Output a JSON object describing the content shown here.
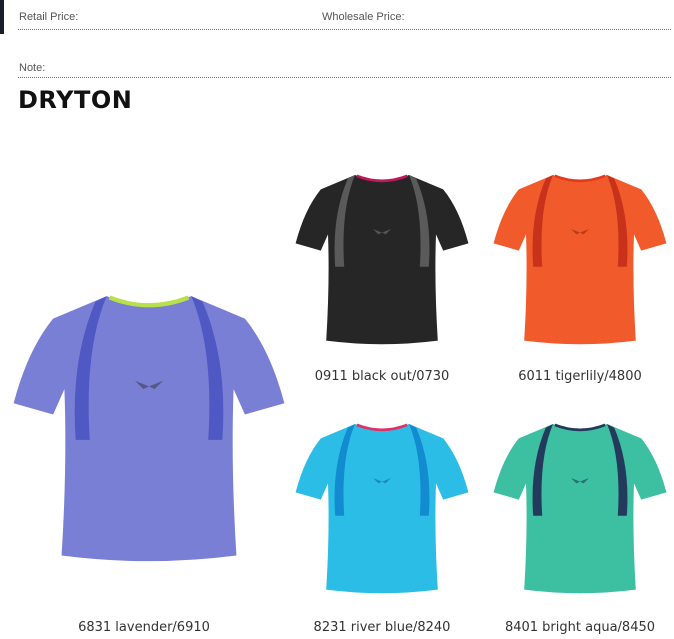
{
  "header": {
    "retail_price_label": "Retail Price:",
    "wholesale_price_label": "Wholesale Price:",
    "note_label": "Note:"
  },
  "product": {
    "name": "DRYTON",
    "variants": [
      {
        "caption": "6831 lavender/6910",
        "body_color": "#7a7fd6",
        "panel_color": "#5058c4",
        "collar_color": "#b8e04a"
      },
      {
        "caption": "0911 black out/0730",
        "body_color": "#262626",
        "panel_color": "#5a5a5a",
        "collar_color": "#c2185b"
      },
      {
        "caption": "6011 tigerlily/4800",
        "body_color": "#f15a2b",
        "panel_color": "#c8321a",
        "collar_color": "#e63a1e"
      },
      {
        "caption": "8231 river blue/8240",
        "body_color": "#2bbde6",
        "panel_color": "#138bd0",
        "collar_color": "#e0306a"
      },
      {
        "caption": "8401 bright aqua/8450",
        "body_color": "#3dbfa2",
        "panel_color": "#243a5c",
        "collar_color": "#243a5c"
      }
    ]
  }
}
